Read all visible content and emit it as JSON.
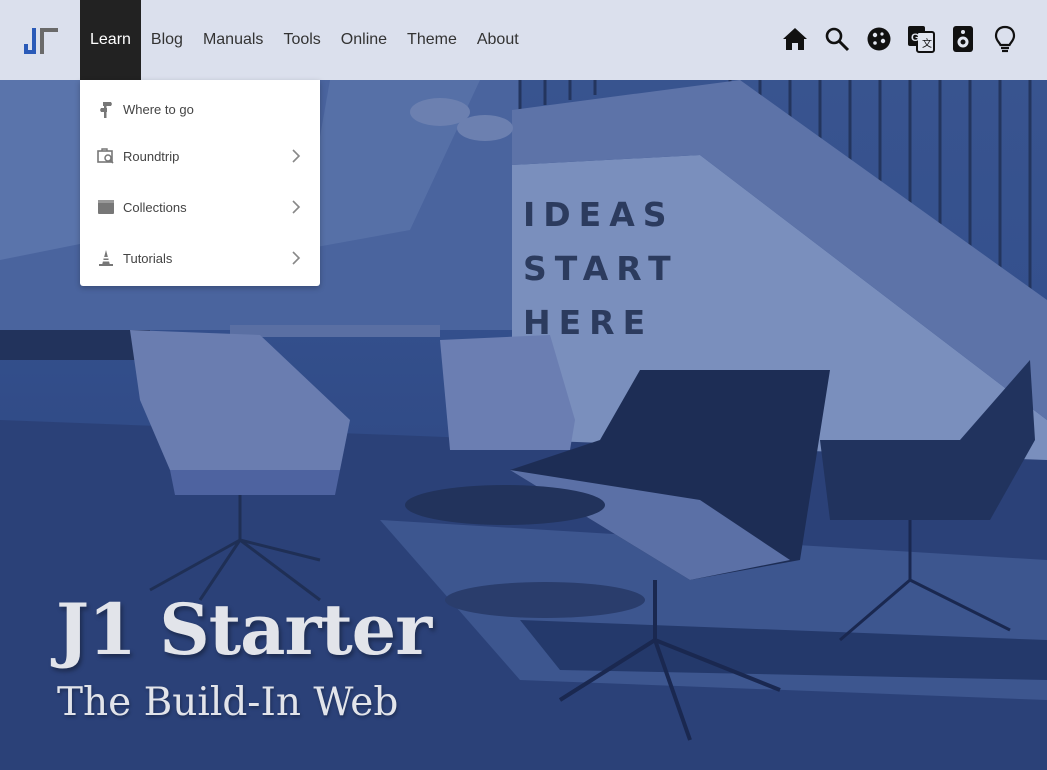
{
  "navbar": {
    "items": [
      {
        "label": "Learn",
        "active": true
      },
      {
        "label": "Blog"
      },
      {
        "label": "Manuals"
      },
      {
        "label": "Tools"
      },
      {
        "label": "Online"
      },
      {
        "label": "Theme"
      },
      {
        "label": "About"
      }
    ],
    "icons": [
      "home-icon",
      "search-icon",
      "cookie-icon",
      "translate-icon",
      "speaker-icon",
      "lightbulb-icon"
    ]
  },
  "dropdown": {
    "items": [
      {
        "label": "Where to go",
        "icon": "signpost-icon",
        "submenu": false
      },
      {
        "label": "Roundtrip",
        "icon": "map-search-icon",
        "submenu": true
      },
      {
        "label": "Collections",
        "icon": "collection-icon",
        "submenu": true
      },
      {
        "label": "Tutorials",
        "icon": "tutorial-icon",
        "submenu": true
      }
    ]
  },
  "hero": {
    "title": "J1 Starter",
    "subtitle": "The Build-In Web",
    "wall_text": "IDEAS\nSTART\nHERE"
  },
  "colors": {
    "overlay": "#34508d",
    "navbar_bg": "#e2e6f0",
    "active_nav_bg": "#222222",
    "logo_blue": "#2a5ab8"
  }
}
